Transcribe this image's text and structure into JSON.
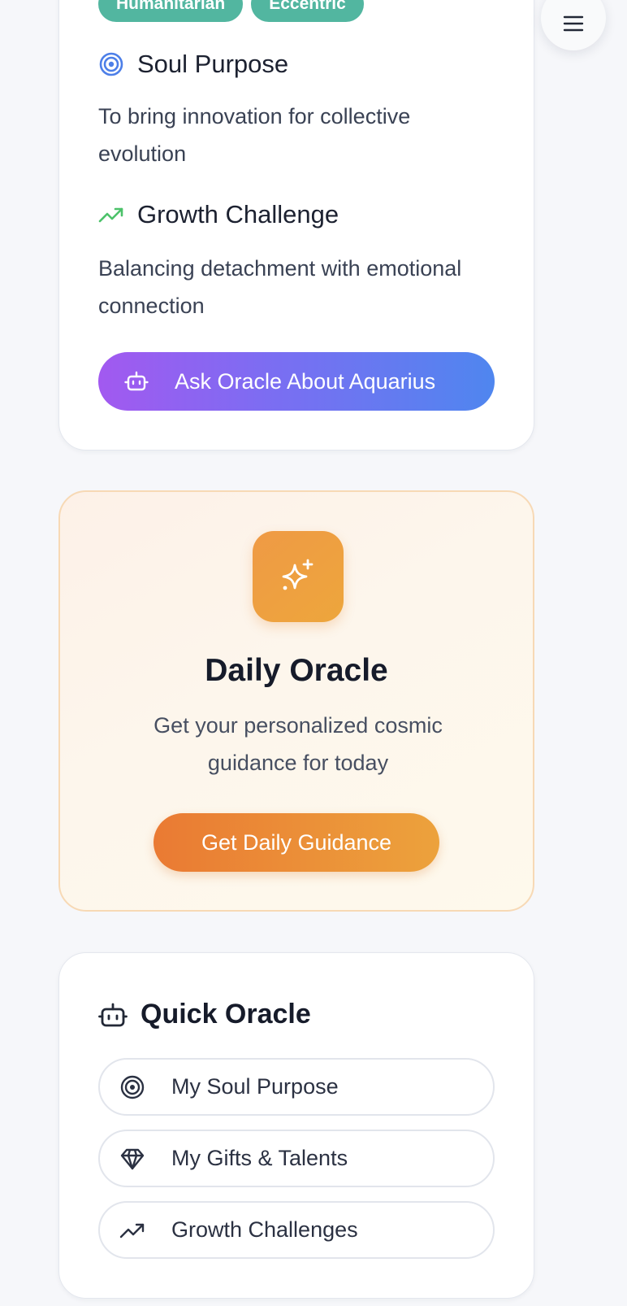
{
  "menu": {
    "icon": "hamburger-menu-icon"
  },
  "sign_card": {
    "tags": [
      "Humanitarian",
      "Eccentric"
    ],
    "soul_purpose": {
      "icon": "target-icon",
      "title": "Soul Purpose",
      "text": "To bring innovation for collective evolution"
    },
    "growth_challenge": {
      "icon": "trending-up-icon",
      "title": "Growth Challenge",
      "text": "Balancing detachment with emotional connection"
    },
    "ask_button": {
      "icon": "robot-icon",
      "label": "Ask Oracle About Aquarius"
    }
  },
  "daily_oracle": {
    "icon": "sparkles-icon",
    "title": "Daily Oracle",
    "description": "Get your personalized cosmic guidance for today",
    "button_label": "Get Daily Guidance"
  },
  "quick_oracle": {
    "icon": "robot-icon",
    "title": "Quick Oracle",
    "items": [
      {
        "icon": "target-icon",
        "label": "My Soul Purpose"
      },
      {
        "icon": "diamond-icon",
        "label": "My Gifts & Talents"
      },
      {
        "icon": "trending-up-icon",
        "label": "Growth Challenges"
      }
    ]
  },
  "colors": {
    "tag_bg": "#52b6a0",
    "ask_gradient_start": "#a259f0",
    "ask_gradient_end": "#4f86ef",
    "oracle_accent": "#ee9a40",
    "growth_icon": "#4cc26a",
    "target_icon": "#4d7fe8"
  }
}
